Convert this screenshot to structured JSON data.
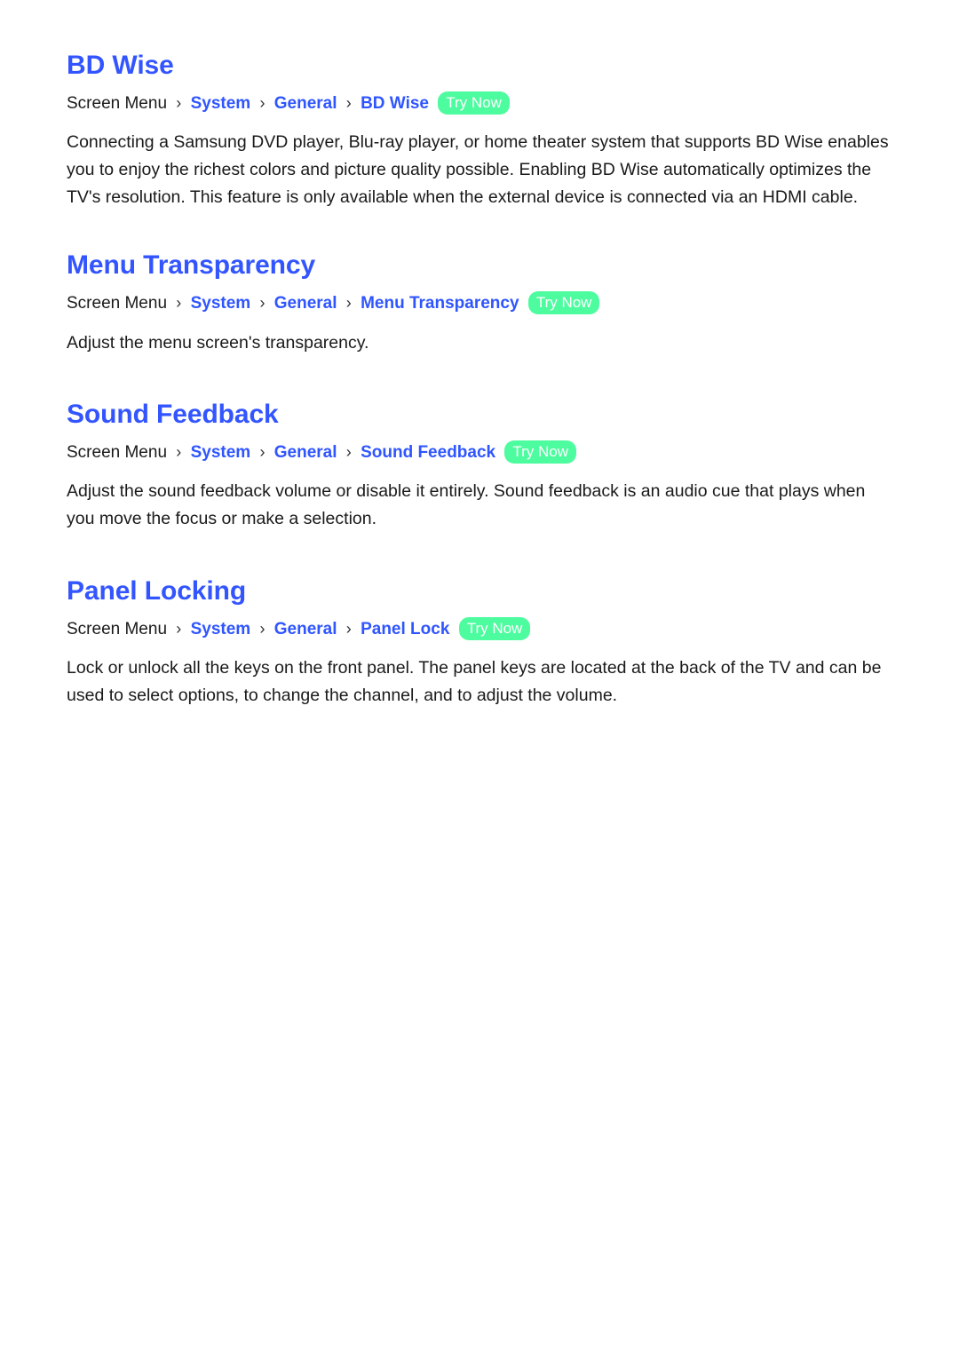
{
  "page": {
    "background_color": "#ffffff",
    "text_color": "#1a1a1a",
    "heading_color": "#3355ff",
    "link_color": "#2f55ff",
    "badge_color": "#4dfc9e",
    "badge_text_color": "#ffffff",
    "separator_glyph": "›"
  },
  "sections": [
    {
      "id": "bd-wise",
      "title": "BD Wise",
      "breadcrumb": {
        "root": "Screen Menu",
        "links": [
          "System",
          "General",
          "BD Wise"
        ],
        "badge": "Try Now"
      },
      "body": "Connecting a Samsung DVD player, Blu-ray player, or home theater system that supports BD Wise enables you to enjoy the richest colors and picture quality possible. Enabling BD Wise automatically optimizes the TV's resolution. This feature is only available when the external device is connected via an HDMI cable."
    },
    {
      "id": "menu-transparency",
      "title": "Menu Transparency",
      "breadcrumb": {
        "root": "Screen Menu",
        "links": [
          "System",
          "General",
          "Menu Transparency"
        ],
        "badge": "Try Now"
      },
      "body": "Adjust the menu screen's transparency."
    },
    {
      "id": "sound-feedback",
      "title": "Sound Feedback",
      "breadcrumb": {
        "root": "Screen Menu",
        "links": [
          "System",
          "General",
          "Sound Feedback"
        ],
        "badge": "Try Now"
      },
      "body": "Adjust the sound feedback volume or disable it entirely. Sound feedback is an audio cue that plays when you move the focus or make a selection."
    },
    {
      "id": "panel-locking",
      "title": "Panel Locking",
      "breadcrumb": {
        "root": "Screen Menu",
        "links": [
          "System",
          "General",
          "Panel Lock"
        ],
        "badge": "Try Now"
      },
      "body": "Lock or unlock all the keys on the front panel. The panel keys are located at the back of the TV and can be used to select options, to change the channel, and to adjust the volume."
    }
  ]
}
